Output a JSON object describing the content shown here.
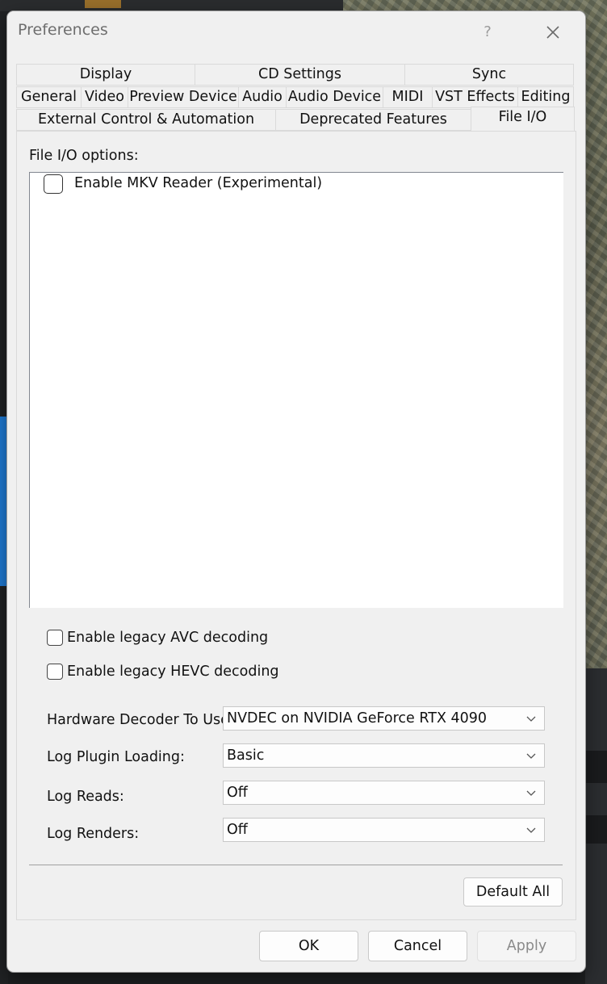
{
  "window": {
    "title": "Preferences",
    "help_label": "?"
  },
  "tabs": {
    "row1": [
      "Display",
      "CD Settings",
      "Sync"
    ],
    "row2": [
      "General",
      "Video",
      "Preview Device",
      "Audio",
      "Audio Device",
      "MIDI",
      "VST Effects",
      "Editing"
    ],
    "row3": [
      "External Control & Automation",
      "Deprecated Features",
      "File I/O"
    ],
    "active": "File I/O"
  },
  "file_io": {
    "group_label": "File I/O options:",
    "options": [
      {
        "label": "Enable MKV Reader (Experimental)",
        "checked": false
      }
    ],
    "legacy_avc": {
      "label": "Enable legacy AVC decoding",
      "checked": false
    },
    "legacy_hevc": {
      "label": "Enable legacy HEVC decoding",
      "checked": false
    },
    "hardware_decoder": {
      "label": "Hardware Decoder To Use:",
      "value": "NVDEC on NVIDIA GeForce RTX 4090"
    },
    "log_plugin_loading": {
      "label": "Log Plugin Loading:",
      "value": "Basic"
    },
    "log_reads": {
      "label": "Log Reads:",
      "value": "Off"
    },
    "log_renders": {
      "label": "Log Renders:",
      "value": "Off"
    },
    "default_all_label": "Default All"
  },
  "footer": {
    "ok_label": "OK",
    "cancel_label": "Cancel",
    "apply_label": "Apply"
  },
  "colors": {
    "dialog_bg": "#f0f0f0",
    "list_bg": "#ffffff",
    "accent_blue": "#1f7ad3"
  }
}
